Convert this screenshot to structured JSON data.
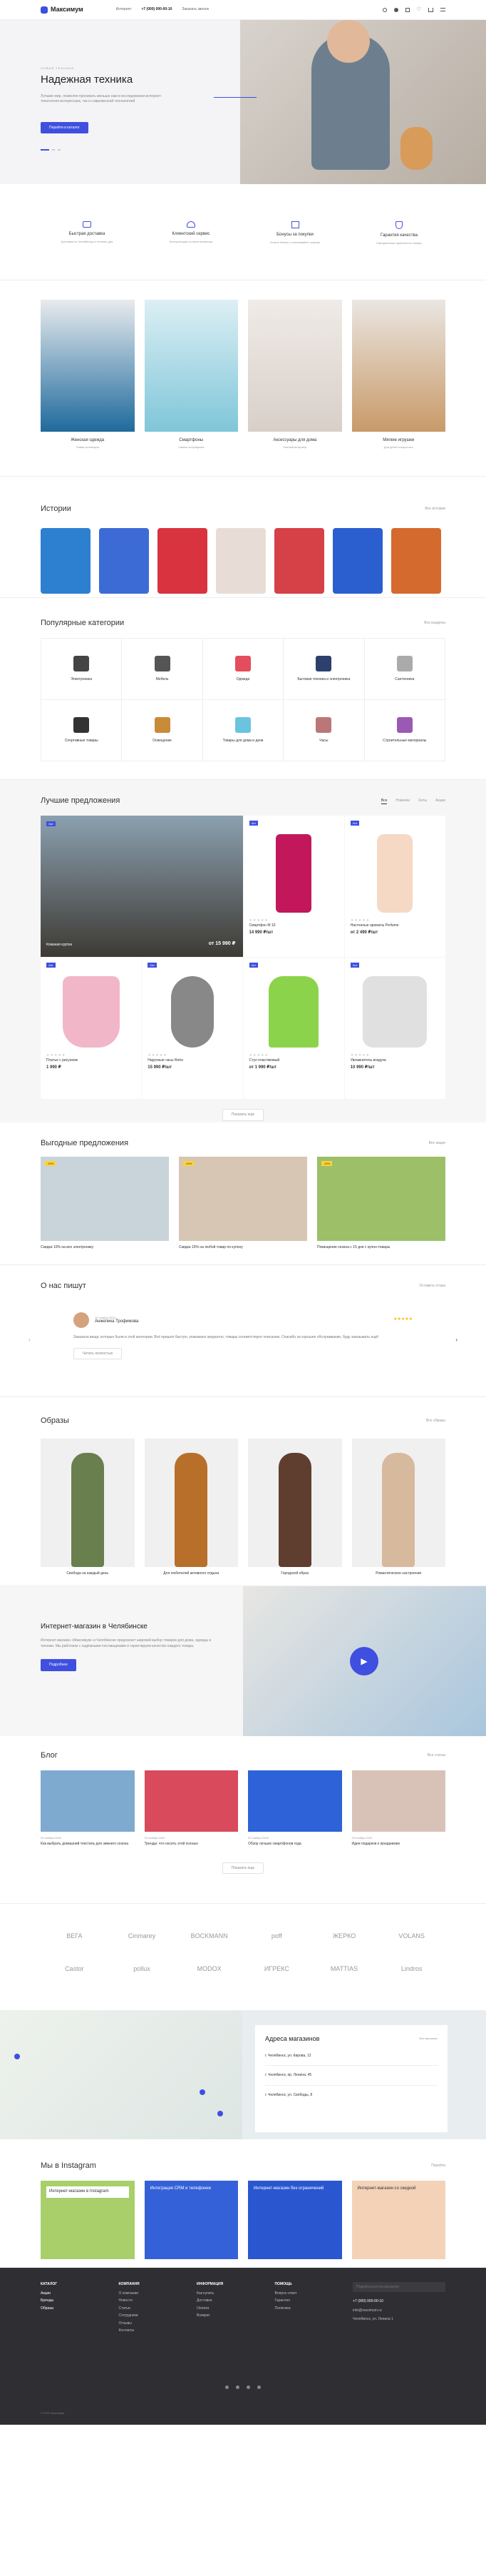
{
  "header": {
    "logo": "Максимум",
    "links": [
      "Интернет",
      "+7 (000) 000-00-10",
      "Заказать звонок"
    ]
  },
  "hero": {
    "tag": "НОВАЯ ТЕХНИКА",
    "title": "Надежная техника",
    "text": "Лучшие мир, позволяя проникать меньше нам в исследовании интернет-технология интересным, так и современной технологией",
    "button": "Перейти в каталог"
  },
  "features": [
    {
      "icon": "truck-icon",
      "title": "Быстрая доставка",
      "text": "Доставка по Челябинску в течение дня"
    },
    {
      "icon": "headset-icon",
      "title": "Клиентский сервис",
      "text": "Консультации по всем вопросам"
    },
    {
      "icon": "gift-icon",
      "title": "Бонусы за покупки",
      "text": "Копите баллы и оплачивайте покупки"
    },
    {
      "icon": "shield-icon",
      "title": "Гарантия качества",
      "text": "Официальная гарантия на товары"
    }
  ],
  "promo_categories": [
    {
      "title": "Женская одежда",
      "sub": "Новая коллекция",
      "color": "#1f6a9c"
    },
    {
      "title": "Смартфоны",
      "sub": "Самые популярные",
      "color": "#7fc6d9"
    },
    {
      "title": "Аксессуары для дома",
      "sub": "Уютный интерьер",
      "color": "#d8cfc8"
    },
    {
      "title": "Мягкие игрушки",
      "sub": "Для детей и взрослых",
      "color": "#c89a69"
    }
  ],
  "stories": {
    "title": "Истории",
    "link": "Все истории",
    "colors": [
      "#2d7fd0",
      "#3d6bd6",
      "#d93340",
      "#e8ddd6",
      "#d64047",
      "#2b5fd0",
      "#d56a2e"
    ]
  },
  "popular": {
    "title": "Популярные категории",
    "link": "Все разделы",
    "items": [
      {
        "name": "Электроника",
        "color": "#444"
      },
      {
        "name": "Мебель",
        "color": "#555"
      },
      {
        "name": "Одежда",
        "color": "#e44d5d"
      },
      {
        "name": "Бытовая техника и электроника",
        "color": "#2d3f6b"
      },
      {
        "name": "Сантехника",
        "color": "#aaa"
      },
      {
        "name": "Спортивные товары",
        "color": "#333"
      },
      {
        "name": "Освещение",
        "color": "#c98a3a"
      },
      {
        "name": "Товары для дома и дачи",
        "color": "#6bc3e0"
      },
      {
        "name": "Часы",
        "color": "#b77"
      },
      {
        "name": "Строительные материалы",
        "color": "#9b59b6"
      }
    ]
  },
  "best": {
    "title": "Лучшие предложения",
    "tabs": [
      "Все",
      "Новинки",
      "Хиты",
      "Акции"
    ],
    "featured": {
      "badge": "Хит",
      "name": "Кожаная куртка",
      "price": "от 15 990 ₽"
    },
    "products": [
      {
        "badge": "Хит",
        "name": "Смартфон М 10",
        "price": "14 990 ₽/шт",
        "color": "#c2185b"
      },
      {
        "badge": "Хит",
        "name": "Настенные ароматы Perfume",
        "price": "от 2 490 ₽/шт",
        "color": "#f5d9c4"
      },
      {
        "badge": "Хит",
        "name": "Платье с рисунком",
        "price": "1 990 ₽",
        "color": "#f1b7c8"
      },
      {
        "badge": "Хит",
        "name": "Наручные часы Retro",
        "price": "15 990 ₽/шт",
        "color": "#888"
      },
      {
        "badge": "Хит",
        "name": "Стул пластиковый",
        "price": "от 1 990 ₽/шт",
        "color": "#8bd34a"
      },
      {
        "badge": "Хит",
        "name": "Увлажнитель воздуха",
        "price": "10 990 ₽/шт",
        "color": "#e0e0e0"
      }
    ],
    "more": "Показать еще"
  },
  "deals": {
    "title": "Выгодные предложения",
    "link": "Все акции",
    "items": [
      {
        "tag": "-10%",
        "text": "Скидка 10% на все электронику",
        "color": "#c9d3da"
      },
      {
        "tag": "-15%",
        "text": "Скидка 15% на любой товар по купону",
        "color": "#d6c6b3"
      },
      {
        "tag": "-20%",
        "text": "Помещение сезона с 15 дня с купон-товары",
        "color": "#9cbf68"
      }
    ]
  },
  "reviews": {
    "title": "О нас пишут",
    "link": "Оставить отзыв",
    "date": "10 ноября 2020",
    "author": "Анжелика Трофимова",
    "text": "Заказала вещи, которые были в этой категории. Всё пришло быстро, упаковано аккуратно, товары соответствуют описанию. Спасибо за хорошее обслуживание, буду заказывать ещё!",
    "button": "Читать полностью"
  },
  "looks": {
    "title": "Образы",
    "link": "Все образы",
    "items": [
      {
        "name": "Свобода на каждый день",
        "color": "#6a7f4e"
      },
      {
        "name": "Для любителей активного отдыха",
        "color": "#b86f2a"
      },
      {
        "name": "Городской образ",
        "color": "#5f3d2f"
      },
      {
        "name": "Романтическое настроение",
        "color": "#d7b99d"
      }
    ]
  },
  "about": {
    "title": "Интернет-магазин в Челябинске",
    "text": "Интернет-магазин «Максимум» в Челябинске предлагает широкий выбор товаров для дома, одежды и техники. Мы работаем с надёжными поставщиками и гарантируем качество каждого товара.",
    "button": "Подробнее"
  },
  "blog": {
    "title": "Блог",
    "link": "Все статьи",
    "items": [
      {
        "tag": "20 ноября 2020",
        "text": "Как выбрать домашний текстиль для зимнего сезона",
        "color": "#7faad0"
      },
      {
        "tag": "20 ноября 2020",
        "text": "Тренды: что носить этой осенью",
        "color": "#d84a5c"
      },
      {
        "tag": "20 ноября 2020",
        "text": "Обзор лучших смартфонов года",
        "color": "#2d62d8"
      },
      {
        "tag": "20 ноября 2020",
        "text": "Идеи подарков к праздникам",
        "color": "#d8c2b8"
      }
    ],
    "more": "Показать еще"
  },
  "brands": [
    "ВЕГА",
    "Cinmarey",
    "BOCKMANN",
    "poff",
    "ЖЕРКО",
    "VOLANS",
    "Castor",
    "pollux",
    "MODOX",
    "ИГРЕКС",
    "MATTIAS",
    "Lindros"
  ],
  "map": {
    "title": "Адреса магазинов",
    "link": "Все магазины",
    "addresses": [
      "г. Челябинск, ул. Кирова, 12",
      "г. Челябинск, пр. Ленина, 45",
      "г. Челябинск, ул. Свободы, 8"
    ]
  },
  "instagram": {
    "title": "Мы в Instagram",
    "link": "Перейти",
    "posts": [
      {
        "text": "Интернет-магазин в Instagram",
        "color": "#a8cf6a"
      },
      {
        "text": "Интеграция CRM и телефонии",
        "color": "#3561d8"
      },
      {
        "text": "Интернет-магазин без ограничений",
        "color": "#2a56d0"
      },
      {
        "text": "Интернет-магазин со скидкой",
        "color": "#f3d2b8"
      }
    ]
  },
  "footer": {
    "cols": [
      {
        "title": "КАТАЛОГ",
        "items": [
          "Акции",
          "Бренды",
          "Образы"
        ]
      },
      {
        "title": "КОМПАНИЯ",
        "items": [
          "О компании",
          "Новости",
          "Статьи",
          "Сотрудники",
          "Отзывы",
          "Контакты"
        ]
      },
      {
        "title": "ИНФОРМАЦИЯ",
        "items": [
          "Как купить",
          "Доставка",
          "Оплата",
          "Возврат"
        ]
      },
      {
        "title": "ПОМОЩЬ",
        "items": [
          "Вопрос-ответ",
          "Гарантия",
          "Политика"
        ]
      }
    ],
    "subscribe_placeholder": "Подписаться на рассылку",
    "phone": "+7 (000) 000-00-10",
    "email": "info@maximum.ru",
    "address": "Челябинск, ул. Ленина 1",
    "copyright": "© 2021 Максимум"
  }
}
